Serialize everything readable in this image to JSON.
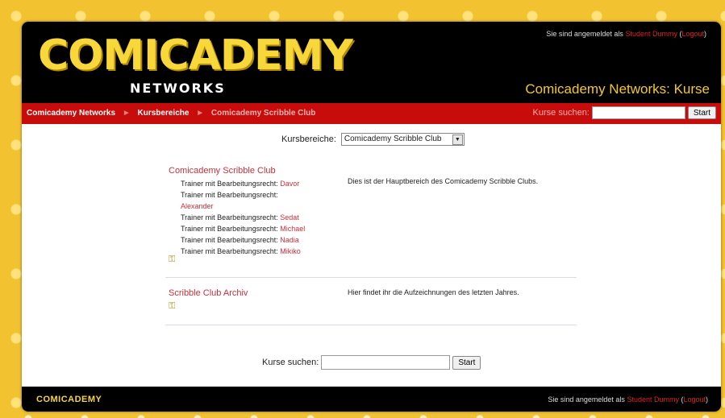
{
  "header": {
    "logo_main": "COMICADEMY",
    "logo_sub": "NETWORKS",
    "login_prefix": "Sie sind angemeldet als",
    "user_name": "Student Dummy",
    "logout_label": "Logout",
    "page_heading": "Comicademy Networks: Kurse"
  },
  "navbar": {
    "breadcrumbs": [
      "Comicademy Networks",
      "Kursbereiche",
      "Comicademy Scribble Club"
    ],
    "separator": "►",
    "search_label": "Kurse suchen:",
    "search_value": "",
    "search_button": "Start"
  },
  "category": {
    "label": "Kursbereiche:",
    "selected": "Comicademy Scribble Club"
  },
  "courses": [
    {
      "name": "Comicademy Scribble Club",
      "summary": "Dies ist der Hauptbereich des Comicademy Scribble Clubs.",
      "role_label": "Trainer mit Bearbeitungsrecht:",
      "teachers": [
        "Davor",
        "Alexander",
        "Sedat",
        "Michael",
        "Nadia",
        "Mikiko"
      ]
    },
    {
      "name": "Scribble Club Archiv",
      "summary": "Hier findet ihr die Aufzeichnungen des letzten Jahres."
    }
  ],
  "search": {
    "label": "Kurse suchen:",
    "value": "",
    "button": "Start"
  },
  "footer": {
    "logo": "COMICADEMY",
    "login_prefix": "Sie sind angemeldet als",
    "user_name": "Student Dummy",
    "logout_label": "Logout"
  },
  "icons": {
    "key": "key-icon",
    "dropdown": "chevron-down-icon"
  },
  "colors": {
    "accent_yellow": "#f4c82c",
    "nav_red": "#c80c0c",
    "link_red": "#c8303a"
  }
}
